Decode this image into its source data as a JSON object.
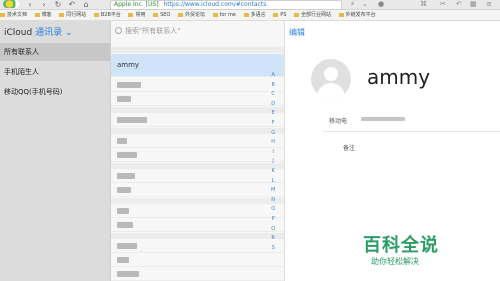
{
  "browser": {
    "secure_label": "Apple Inc. [US]",
    "url": "https://www.icloud.com/#contacts",
    "bookmarks": [
      "技术文档",
      "博客",
      "同行网站",
      "B2B平台",
      "常用",
      "SEO",
      "外贸论坛",
      "for me",
      "多语言",
      "PS",
      "全部行业网站",
      "外链发布平台"
    ]
  },
  "sidebar": {
    "brand_app": "iCloud",
    "brand_section": "通讯录",
    "items": [
      {
        "label": "所有联系人"
      },
      {
        "label": "手机陌生人"
      },
      {
        "label": "移动QQ(手机号码)"
      }
    ]
  },
  "list": {
    "search_placeholder": "搜索\"所有联系人\"",
    "selected_contact": "ammy",
    "alphabet": [
      "A",
      "B",
      "C",
      "D",
      "E",
      "F",
      "G",
      "H",
      "I",
      "J",
      "K",
      "L",
      "M",
      "N",
      "O",
      "P",
      "Q",
      "R",
      "S"
    ]
  },
  "detail": {
    "edit_label": "编辑",
    "name": "ammy",
    "phone_label": "移动电",
    "note_label": "备注"
  },
  "watermark": {
    "main": "百科全说",
    "sub": "助你轻松解决"
  }
}
